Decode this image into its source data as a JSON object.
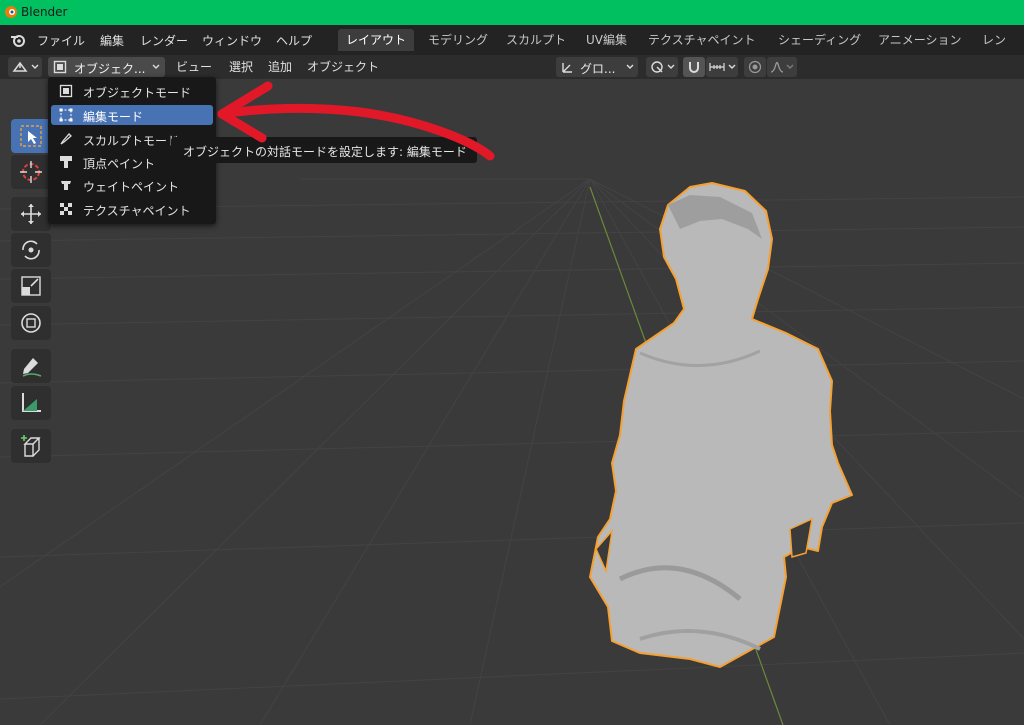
{
  "window": {
    "title": "Blender"
  },
  "menubar": {
    "items": [
      "ファイル",
      "編集",
      "レンダー",
      "ウィンドウ",
      "ヘルプ"
    ],
    "workspaces": [
      "レイアウト",
      "モデリング",
      "スカルプト",
      "UV編集",
      "テクスチャペイント",
      "シェーディング",
      "アニメーション",
      "レンダリ"
    ],
    "active_workspace": "レイアウト"
  },
  "header": {
    "mode_label": "オブジェク...",
    "menus": [
      "ビュー",
      "選択",
      "追加",
      "オブジェクト"
    ],
    "transform_orientation": "グロ..."
  },
  "mode_menu": {
    "items": [
      {
        "label": "オブジェクトモード",
        "icon": "object-mode-icon"
      },
      {
        "label": "編集モード",
        "icon": "edit-mode-icon"
      },
      {
        "label": "スカルプトモード",
        "icon": "sculpt-mode-icon"
      },
      {
        "label": "頂点ペイント",
        "icon": "vertex-paint-icon"
      },
      {
        "label": "ウェイトペイント",
        "icon": "weight-paint-icon"
      },
      {
        "label": "テクスチャペイント",
        "icon": "texture-paint-icon"
      }
    ],
    "selected": "編集モード"
  },
  "tooltip": {
    "text": "オブジェクトの対話モードを設定します:  編集モード"
  },
  "toolbar": {
    "tools": [
      "select-box-icon",
      "cursor-icon",
      "move-icon",
      "rotate-icon",
      "scale-icon",
      "transform-icon",
      "annotate-icon",
      "measure-icon",
      "add-cube-icon"
    ],
    "active_tool": "select-box-icon"
  },
  "colors": {
    "titlebar": "#00c060",
    "selection": "#4772b3",
    "outline": "#f5a030",
    "annotation_arrow": "#e01828"
  }
}
